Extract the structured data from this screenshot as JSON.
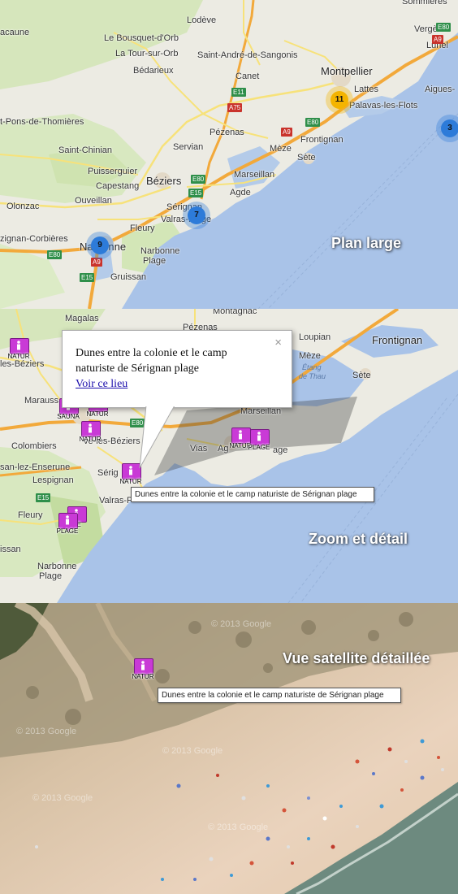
{
  "panels": {
    "wide": {
      "caption": "Plan large",
      "labels": {
        "sommieres": "Sommières",
        "lodeve": "Lodève",
        "lacaune": "acaune",
        "bousquet": "Le Bousquet-d'Orb",
        "tour_sur_orb": "La Tour-sur-Orb",
        "st_andre": "Saint-André-de-Sangonis",
        "vergeze": "Vergèze",
        "lunel": "Lunel",
        "bedarieux": "Bédarieux",
        "montpellier": "Montpellier",
        "lattes": "Lattes",
        "aigues": "Aigues-",
        "canet": "Canet",
        "palavas": "Palavas-les-Flots",
        "pons": "t-Pons-de-Thomières",
        "pezenas": "Pézenas",
        "frontignan": "Frontignan",
        "st_chinian": "Saint-Chinian",
        "servian": "Servian",
        "meze": "Mèze",
        "sete": "Sète",
        "puisserguier": "Puisserguier",
        "capestang": "Capestang",
        "beziers": "Béziers",
        "marseillan": "Marseillan",
        "agde": "Agde",
        "ouveillan": "Ouveillan",
        "olonzac": "Olonzac",
        "serignan": "Sérignan",
        "valras": "Valras-Plage",
        "fleury": "Fleury",
        "lezignan": "zignan-Corbières",
        "narbonne": "Narbonne",
        "narbonne_plage_1": "Narbonne",
        "narbonne_plage_2": "Plage",
        "gruissan": "Gruissan"
      },
      "roads": [
        "E80",
        "A9",
        "E11",
        "A75",
        "E80",
        "A9",
        "E80",
        "E15",
        "A9",
        "E80",
        "E15"
      ],
      "clusters": [
        {
          "count": "11",
          "color": "#f4b400"
        },
        {
          "count": "3",
          "color": "#2d7bd9"
        },
        {
          "count": "7",
          "color": "#2d7bd9"
        },
        {
          "count": "9",
          "color": "#2d7bd9"
        }
      ]
    },
    "zoom": {
      "caption": "Zoom et détail",
      "labels": {
        "magalas": "Magalas",
        "montagnac": "Montagnac",
        "pezenas": "Pézenas",
        "loupian": "Loupian",
        "frontignan": "Frontignan",
        "lesbeziers": "les-Béziers",
        "meze": "Mèze",
        "etang_1": "Étang",
        "etang_2": "de Thau",
        "sete": "Sète",
        "marausson": "Marauss",
        "marseillan": "Marseillan",
        "colombiers": "Colombiers",
        "villeneuve": "ve-lès-Béziers",
        "vias": "Vias",
        "agde": "Ag",
        "agde_plage": "age",
        "lez_enserune": "san-lez-Enserune",
        "serignan": "Sérig",
        "lespignan": "Lespignan",
        "valras": "Valras-P",
        "fleury": "Fleury",
        "nissan": "issan",
        "narbonne": "Narbonne",
        "plage": "Plage"
      },
      "roads": [
        "E80",
        "E15"
      ],
      "markers": {
        "natur": "NATUR",
        "sauna": "SAUNA",
        "plage": "PLAGE",
        "ge": "GE"
      },
      "infowindow": {
        "text": "Dunes entre la colonie et le camp naturiste de Sérignan plage",
        "link": "Voir ce lieu",
        "close": "×"
      },
      "tooltip": "Dunes entre la colonie et le camp naturiste de Sérignan plage"
    },
    "satellite": {
      "caption": "Vue satellite détaillée",
      "marker_label": "NATUR",
      "tooltip": "Dunes entre la colonie et le camp naturiste de Sérignan plage",
      "watermarks": [
        "© 2013 Google",
        "© 2013 Google",
        "© 2013 Google",
        "© 2013 Google",
        "© 2013 Google"
      ]
    }
  },
  "colors": {
    "land": "#ecebe3",
    "green": "#cfe3b0",
    "sea": "#a9c3e8",
    "road_orange": "#f2a93b",
    "road_yellow": "#f7e27a",
    "marker": "#c93ad6",
    "sand": "#e6cdb4"
  }
}
